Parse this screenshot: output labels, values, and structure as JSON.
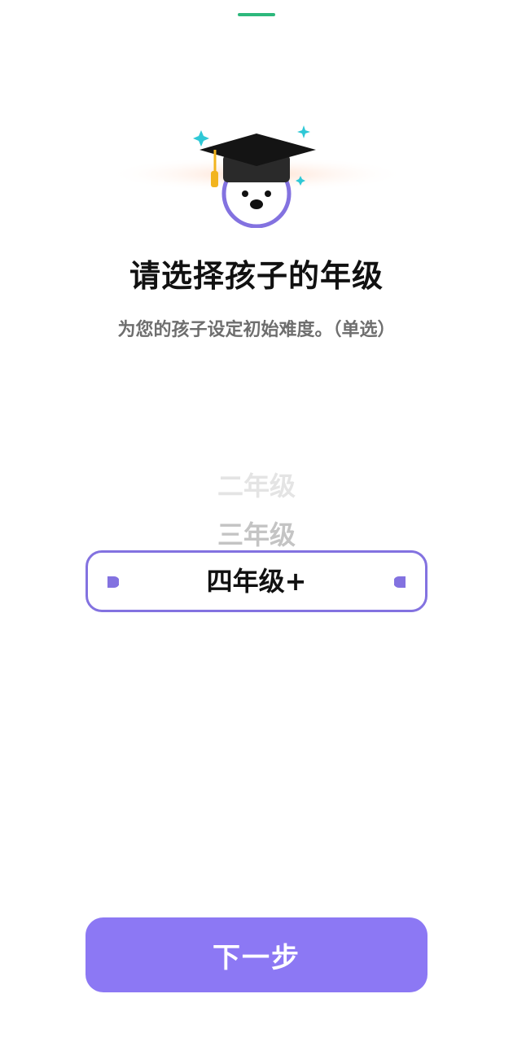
{
  "header": {
    "progress_color": "#2db87c"
  },
  "mascot": {
    "icon": "graduation-cap-mascot-icon"
  },
  "title": "请选择孩子的年级",
  "subtitle": "为您的孩子设定初始难度。（单选）",
  "grade_picker": {
    "options": [
      "二年级",
      "三年级",
      "四年级+"
    ],
    "selected": "四年级+"
  },
  "next_button": {
    "label": "下一步",
    "color": "#8c78f4"
  },
  "colors": {
    "accent": "#8372e0",
    "progress": "#2db87c"
  }
}
